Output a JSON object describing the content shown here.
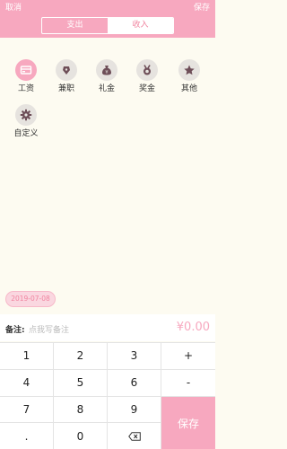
{
  "header": {
    "cancel_label": "取消",
    "save_label": "保存",
    "tabs": [
      {
        "label": "支出",
        "active": false
      },
      {
        "label": "收入",
        "active": true
      }
    ],
    "accent_color": "#F7A8BF"
  },
  "categories": [
    {
      "label": "工资",
      "icon": "wallet-icon",
      "selected": true
    },
    {
      "label": "兼职",
      "icon": "pen-icon",
      "selected": false
    },
    {
      "label": "礼金",
      "icon": "money-bag-icon",
      "selected": false
    },
    {
      "label": "奖金",
      "icon": "medal-icon",
      "selected": false
    },
    {
      "label": "其他",
      "icon": "star-icon",
      "selected": false
    },
    {
      "label": "自定义",
      "icon": "gear-icon",
      "selected": false
    }
  ],
  "date": "2019-07-08",
  "note": {
    "label": "备注:",
    "placeholder": "点我写备注",
    "amount": "¥0.00"
  },
  "keypad": {
    "keys": [
      "1",
      "2",
      "3",
      "+",
      "4",
      "5",
      "6",
      "-",
      "7",
      "8",
      "9",
      ".",
      "0"
    ],
    "backspace_icon": "backspace-icon",
    "save_label": "保存"
  }
}
